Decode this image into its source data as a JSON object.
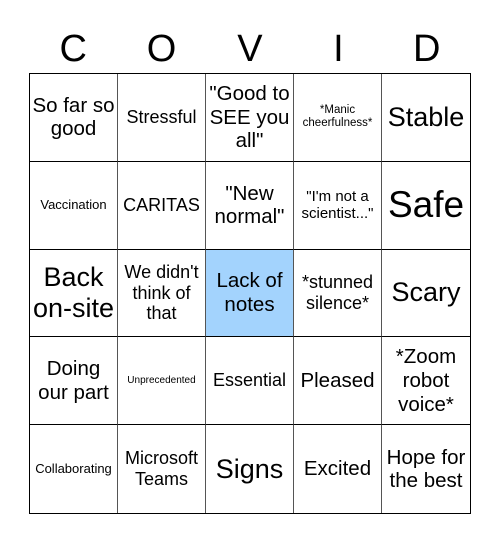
{
  "title_letters": [
    "C",
    "O",
    "V",
    "I",
    "D"
  ],
  "highlight_color": "#a3d3fd",
  "cells": [
    {
      "text": "So far so good",
      "size": "l"
    },
    {
      "text": "Stressful",
      "size": "m"
    },
    {
      "text": "\"Good to SEE you all\"",
      "size": "l"
    },
    {
      "text": "*Manic cheerfulness*",
      "size": "xs"
    },
    {
      "text": "Stable",
      "size": "xl"
    },
    {
      "text": "Vaccination",
      "size": "s"
    },
    {
      "text": "CARITAS",
      "size": "m"
    },
    {
      "text": "\"New normal\"",
      "size": "l"
    },
    {
      "text": "\"I'm not a scientist...\"",
      "size": "sm"
    },
    {
      "text": "Safe",
      "size": "xxl"
    },
    {
      "text": "Back on-site",
      "size": "xl"
    },
    {
      "text": "We didn't think of that",
      "size": "m"
    },
    {
      "text": "Lack of notes",
      "size": "l",
      "marked": true
    },
    {
      "text": "*stunned silence*",
      "size": "m"
    },
    {
      "text": "Scary",
      "size": "xl"
    },
    {
      "text": "Doing our part",
      "size": "l"
    },
    {
      "text": "Unprecedented",
      "size": "xxs"
    },
    {
      "text": "Essential",
      "size": "m"
    },
    {
      "text": "Pleased",
      "size": "l"
    },
    {
      "text": "*Zoom robot voice*",
      "size": "l"
    },
    {
      "text": "Collaborating",
      "size": "s"
    },
    {
      "text": "Microsoft Teams",
      "size": "m"
    },
    {
      "text": "Signs",
      "size": "xl"
    },
    {
      "text": "Excited",
      "size": "l"
    },
    {
      "text": "Hope for the best",
      "size": "l"
    }
  ]
}
